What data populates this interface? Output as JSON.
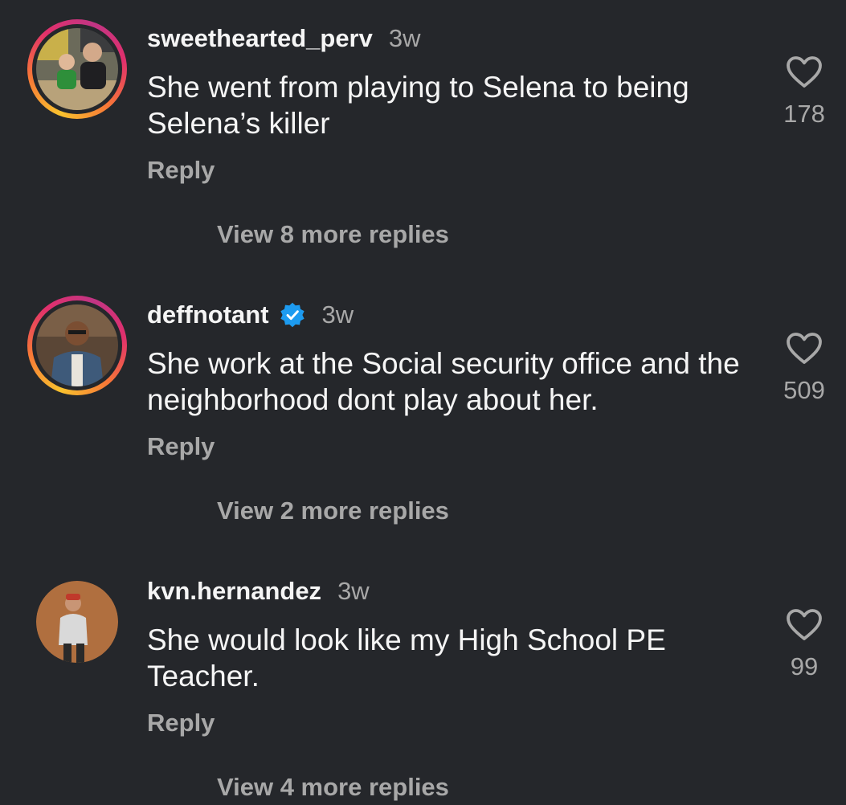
{
  "comments": [
    {
      "username": "sweethearted_perv",
      "verified": false,
      "time": "3w",
      "text": "She went from playing to Selena to being Selena’s killer",
      "reply_label": "Reply",
      "likes": "178",
      "view_more": "View 8 more replies",
      "avatar_story_ring": true
    },
    {
      "username": "deffnotant",
      "verified": true,
      "time": "3w",
      "text": "She work at the Social security office and the neighborhood dont play about her.",
      "reply_label": "Reply",
      "likes": "509",
      "view_more": "View 2 more replies",
      "avatar_story_ring": true
    },
    {
      "username": "kvn.hernandez",
      "verified": false,
      "time": "3w",
      "text": "She would look like my High School PE Teacher.",
      "reply_label": "Reply",
      "likes": "99",
      "view_more": "View 4 more replies",
      "avatar_story_ring": false
    }
  ],
  "colors": {
    "background": "#25272b",
    "primary_text": "#f5f5f5",
    "secondary_text": "#a8a8a8",
    "verified_badge": "#1d9bf0",
    "story_ring": [
      "#f9c22e",
      "#f77737",
      "#e1306c",
      "#c13584"
    ]
  },
  "icons": {
    "like": "heart-outline-icon",
    "verified": "verified-badge-icon"
  }
}
